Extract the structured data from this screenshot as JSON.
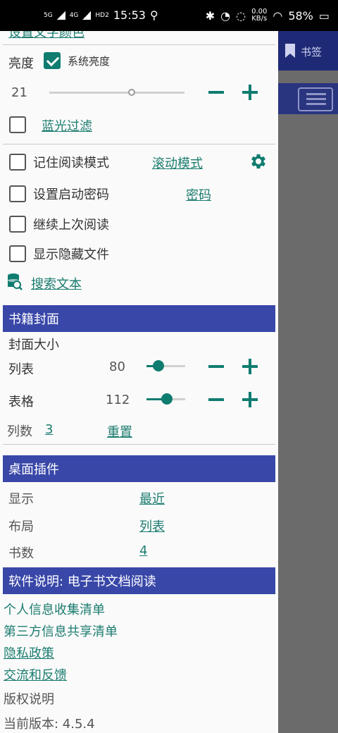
{
  "status": {
    "network1": "5G",
    "network2": "4G",
    "hd": "HD2",
    "time": "15:53",
    "speed_value": "0.00",
    "speed_unit": "KB/s",
    "battery": "58%"
  },
  "background": {
    "bookmark_label": "书签"
  },
  "drawer": {
    "top_cut_link": "设置文字颜色",
    "brightness": {
      "label": "亮度",
      "system_label": "系统亮度",
      "system_checked": true,
      "value": "21",
      "level_fraction": 0.62
    },
    "blue_filter_label": "蓝光过滤",
    "remember_mode_label": "记住阅读模式",
    "scroll_mode_link": "滚动模式",
    "startup_password_label": "设置启动密码",
    "password_link": "密码",
    "continue_reading_label": "继续上次阅读",
    "show_hidden_label": "显示隐藏文件",
    "search_text_link": "搜索文本",
    "cover_section": {
      "title": "书籍封面",
      "size_label": "封面大小",
      "list_label": "列表",
      "list_value": "80",
      "list_fraction": 0.3,
      "grid_label": "表格",
      "grid_value": "112",
      "grid_fraction": 0.52,
      "columns_label": "列数",
      "columns_value": "3",
      "reset_link": "重置"
    },
    "widget_section": {
      "title": "桌面插件",
      "display_label": "显示",
      "display_value": "最近",
      "layout_label": "布局",
      "layout_value": "列表",
      "count_label": "书数",
      "count_value": "4"
    },
    "about_section": {
      "title": "软件说明: 电子书文档阅读",
      "personal_info": "个人信息收集清单",
      "third_party": "第三方信息共享清单",
      "privacy": "隐私政策",
      "feedback": "交流和反馈",
      "copyright": "版权说明",
      "version": "当前版本: 4.5.4"
    }
  },
  "colors": {
    "accent": "#0f7c70",
    "section_bg": "#3947a8",
    "bg_header": "#1f2a77"
  }
}
